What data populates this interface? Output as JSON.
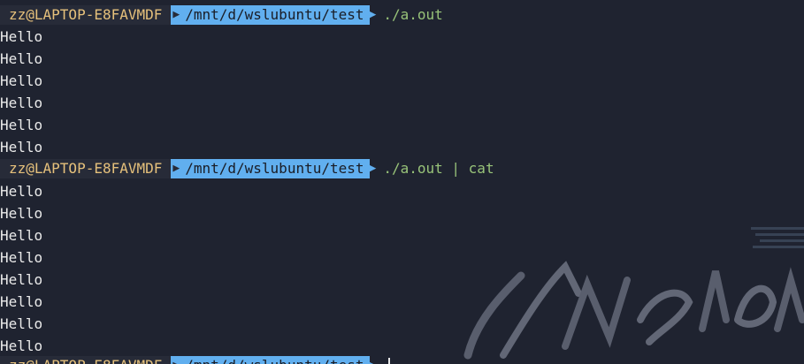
{
  "prompt": {
    "user_host": "zz@LAPTOP-E8FAVMDF",
    "path": "/mnt/d/wslubuntu/test",
    "separator_icon": "powerline-arrow-icon"
  },
  "blocks": [
    {
      "command": "./a.out",
      "output": [
        "Hello",
        "Hello",
        "Hello",
        "Hello",
        "Hello",
        "Hello"
      ]
    },
    {
      "command": "./a.out | cat",
      "output": [
        "Hello",
        "Hello",
        "Hello",
        "Hello",
        "Hello",
        "Hello",
        "Hello",
        "Hello"
      ]
    }
  ],
  "colors": {
    "background": "#1f2330",
    "user_segment_bg": "#272b38",
    "user_text": "#e5c07b",
    "path_segment_bg": "#61afef",
    "command_text": "#98c379",
    "output_text": "#eaeaea"
  }
}
